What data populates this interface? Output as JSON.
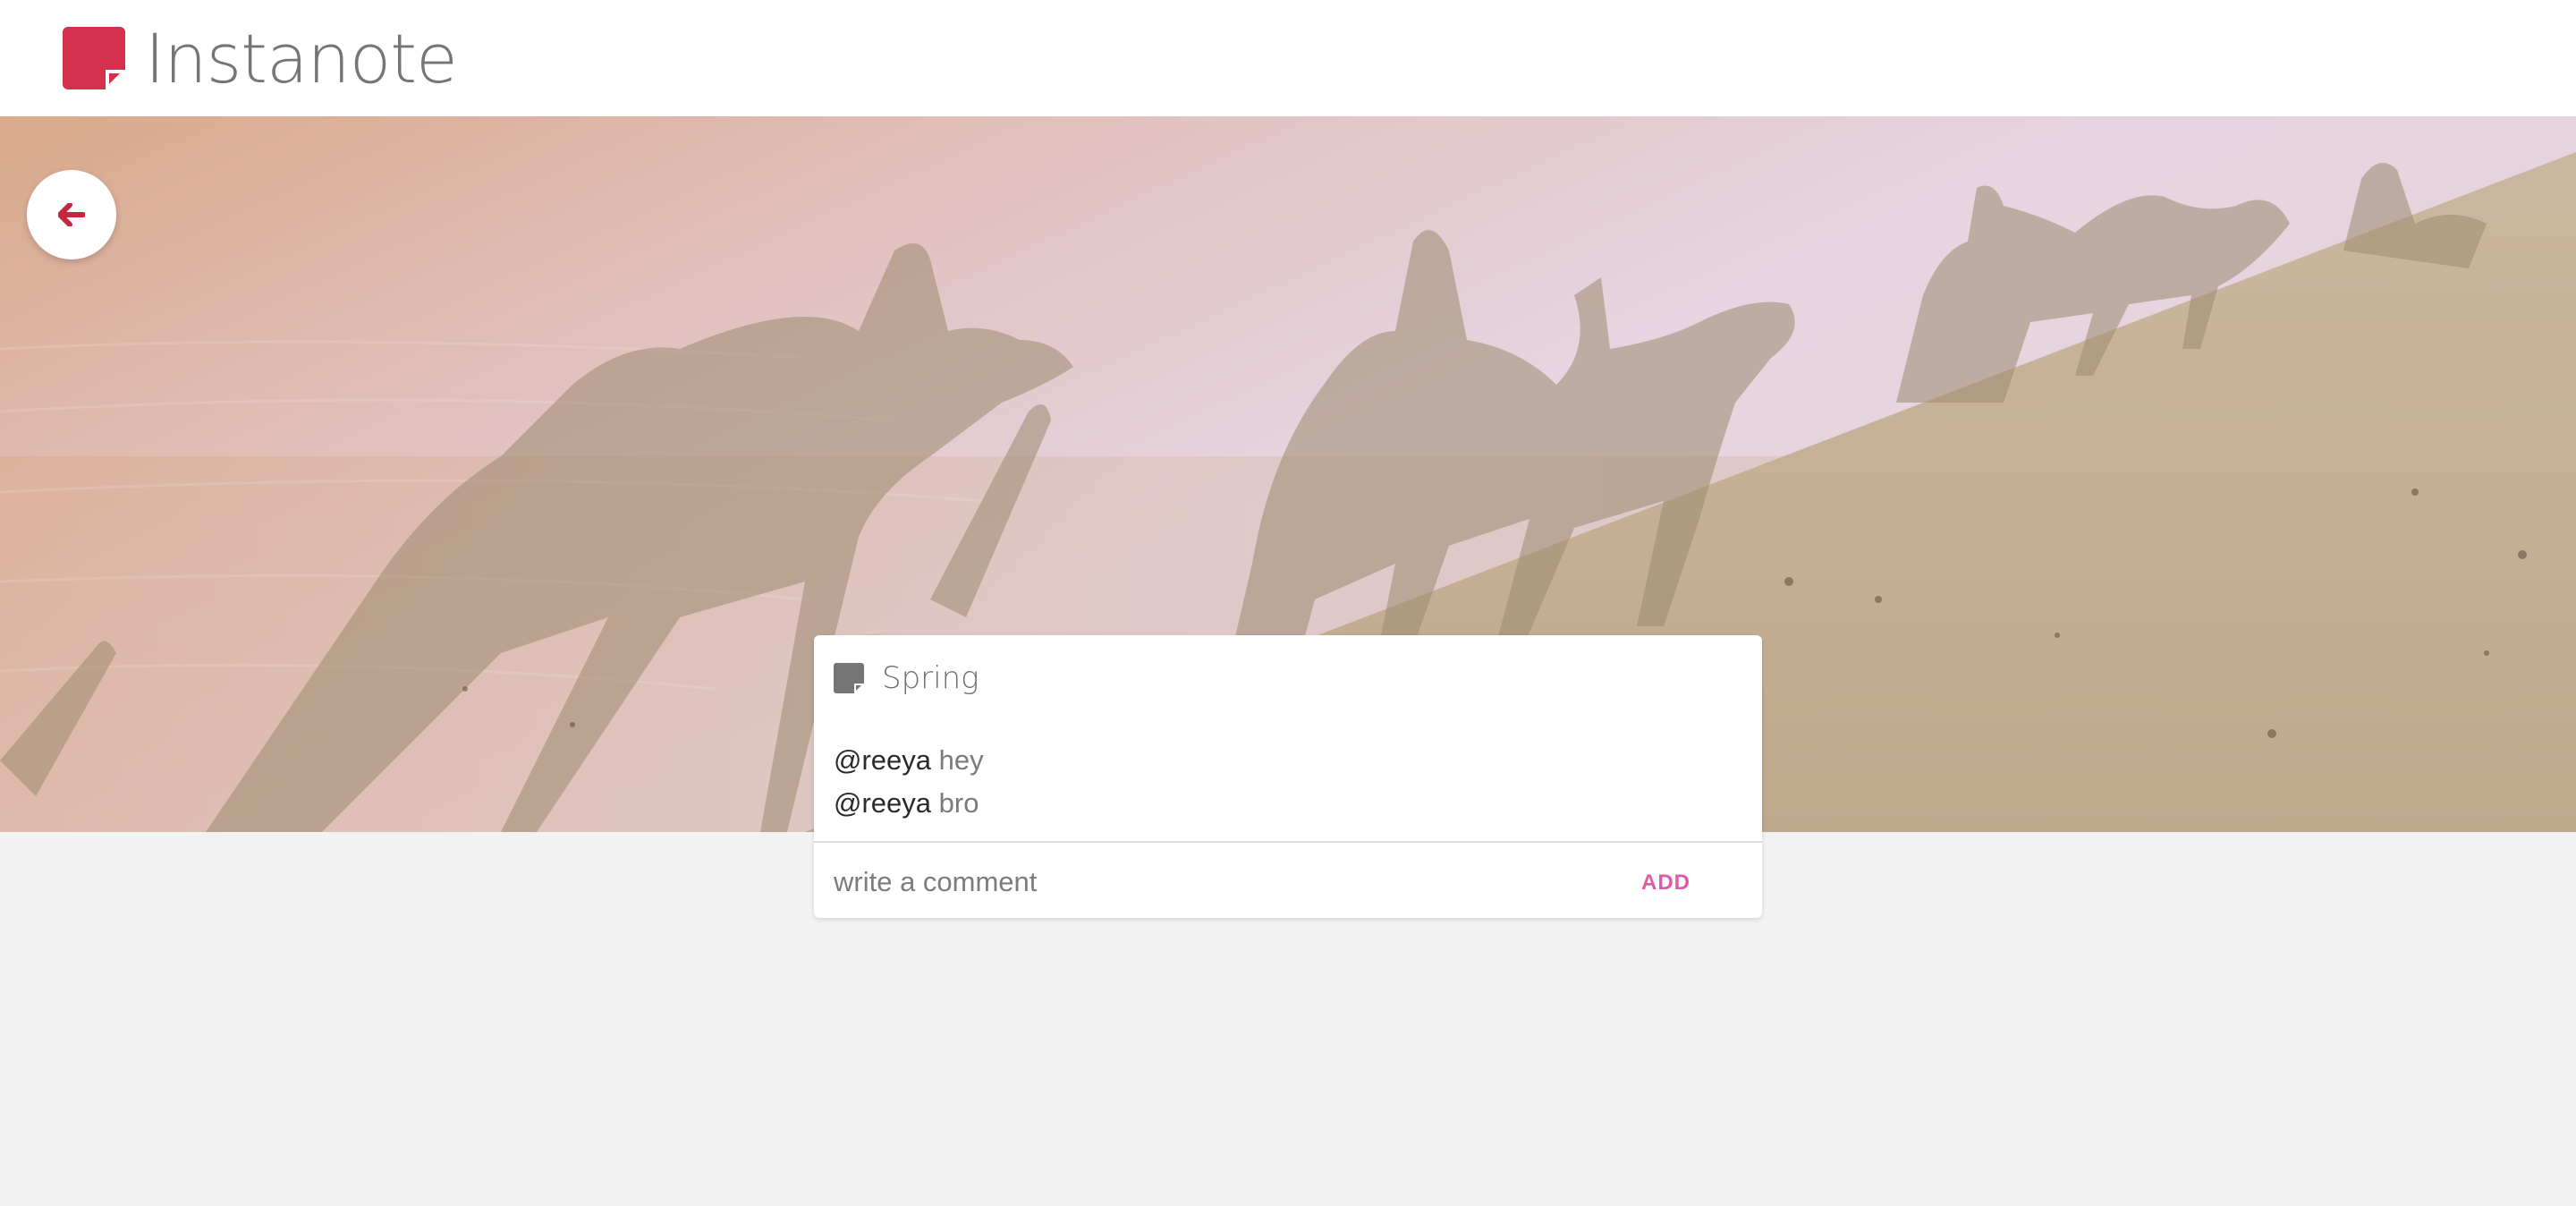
{
  "app": {
    "name": "Instanote",
    "logo_icon": "note-icon",
    "logo_color": "#d4324c"
  },
  "hero": {
    "description_icon": "desert-camel-shadows-photo"
  },
  "nav": {
    "back_icon": "arrow-left-icon",
    "back_icon_color": "#c8263f"
  },
  "note": {
    "icon": "note-icon",
    "title": "Spring",
    "comments": [
      {
        "user": "@reeya",
        "text": "hey"
      },
      {
        "user": "@reeya",
        "text": "bro"
      }
    ],
    "comment_input": {
      "value": "",
      "placeholder": "write a comment"
    },
    "add_label": "ADD",
    "accent_color": "#e05aa6"
  }
}
